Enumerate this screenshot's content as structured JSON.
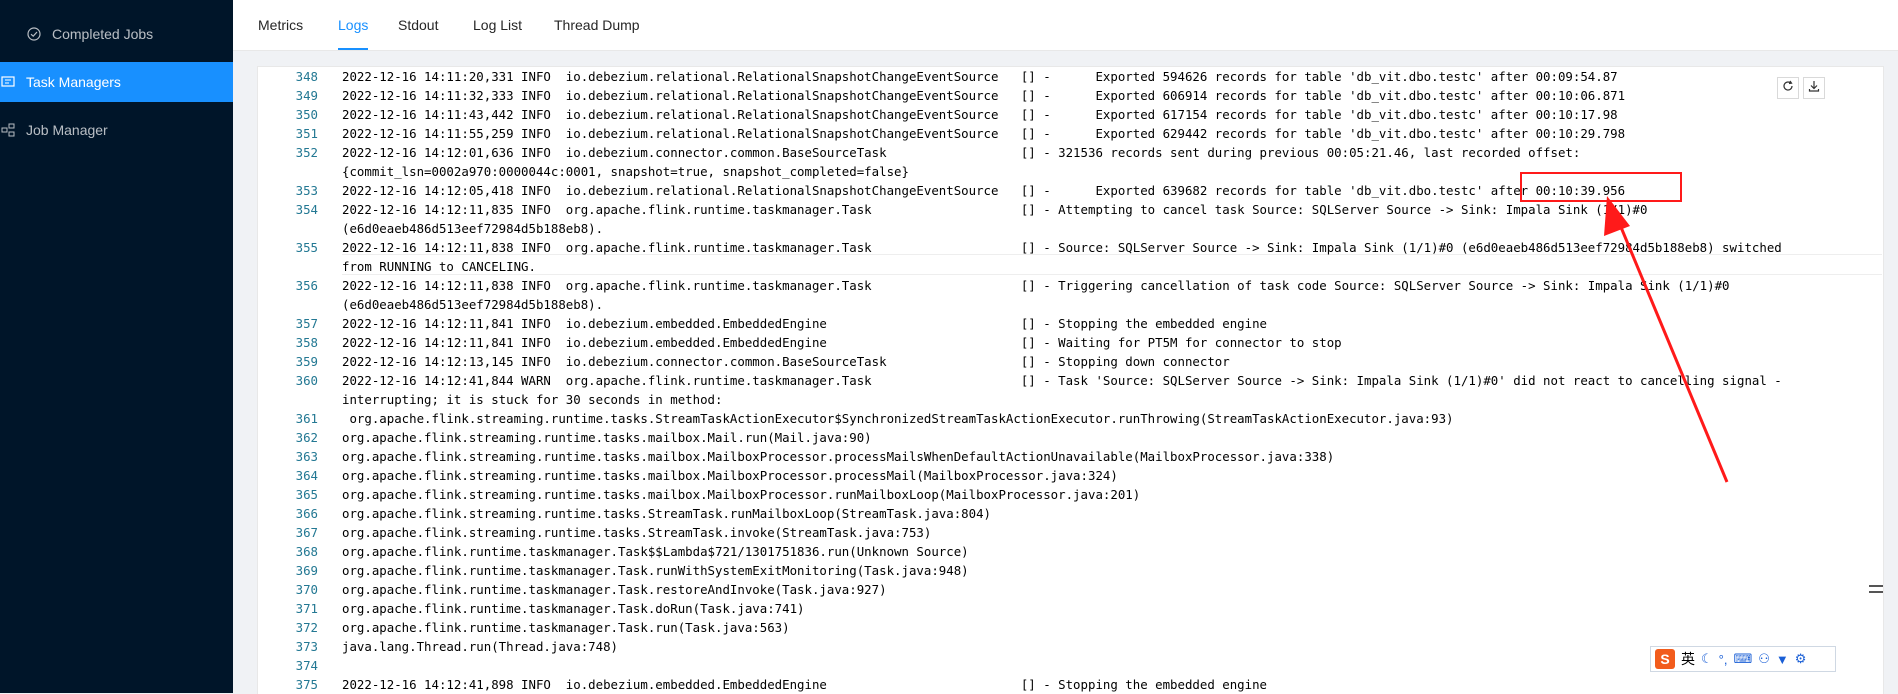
{
  "sidebar": {
    "items": [
      {
        "label": "Completed Jobs",
        "icon": "check-circle-icon"
      },
      {
        "label": "Task Managers",
        "icon": "monitor-icon"
      },
      {
        "label": "Job Manager",
        "icon": "cluster-icon"
      }
    ]
  },
  "tabs": [
    "Metrics",
    "Logs",
    "Stdout",
    "Log List",
    "Thread Dump"
  ],
  "toolbar": {
    "reload_icon": "reload-icon",
    "download_icon": "download-icon"
  },
  "ime": {
    "logo": "S",
    "mode": "英"
  },
  "colors": {
    "sidebar": "#001529",
    "accent": "#1890ff",
    "highlight": "#ff1a1a"
  },
  "log_lines": [
    {
      "n": "348",
      "t": "2022-12-16 14:11:20,331 INFO  io.debezium.relational.RelationalSnapshotChangeEventSource   [] -      Exported 594626 records for table 'db_vit.dbo.testc' after 00:09:54.87"
    },
    {
      "n": "349",
      "t": "2022-12-16 14:11:32,333 INFO  io.debezium.relational.RelationalSnapshotChangeEventSource   [] -      Exported 606914 records for table 'db_vit.dbo.testc' after 00:10:06.871"
    },
    {
      "n": "350",
      "t": "2022-12-16 14:11:43,442 INFO  io.debezium.relational.RelationalSnapshotChangeEventSource   [] -      Exported 617154 records for table 'db_vit.dbo.testc' after 00:10:17.98"
    },
    {
      "n": "351",
      "t": "2022-12-16 14:11:55,259 INFO  io.debezium.relational.RelationalSnapshotChangeEventSource   [] -      Exported 629442 records for table 'db_vit.dbo.testc' after 00:10:29.798"
    },
    {
      "n": "352",
      "t": "2022-12-16 14:12:01,636 INFO  io.debezium.connector.common.BaseSourceTask                  [] - 321536 records sent during previous 00:05:21.46, last recorded offset:"
    },
    {
      "n": "",
      "t": "{commit_lsn=0002a970:0000044c:0001, snapshot=true, snapshot_completed=false}"
    },
    {
      "n": "353",
      "t": "2022-12-16 14:12:05,418 INFO  io.debezium.relational.RelationalSnapshotChangeEventSource   [] -      Exported 639682 records for table 'db_vit.dbo.testc' after 00:10:39.956"
    },
    {
      "n": "354",
      "t": "2022-12-16 14:12:11,835 INFO  org.apache.flink.runtime.taskmanager.Task                    [] - Attempting to cancel task Source: SQLServer Source -> Sink: Impala Sink (1/1)#0"
    },
    {
      "n": "",
      "t": "(e6d0eaeb486d513eef72984d5b188eb8)."
    },
    {
      "n": "355",
      "t": "2022-12-16 14:12:11,838 INFO  org.apache.flink.runtime.taskmanager.Task                    [] - Source: SQLServer Source -> Sink: Impala Sink (1/1)#0 (e6d0eaeb486d513eef72984d5b188eb8) switched"
    },
    {
      "n": "",
      "t": "from RUNNING to CANCELING."
    },
    {
      "n": "356",
      "t": "2022-12-16 14:12:11,838 INFO  org.apache.flink.runtime.taskmanager.Task                    [] - Triggering cancellation of task code Source: SQLServer Source -> Sink: Impala Sink (1/1)#0"
    },
    {
      "n": "",
      "t": "(e6d0eaeb486d513eef72984d5b188eb8)."
    },
    {
      "n": "357",
      "t": "2022-12-16 14:12:11,841 INFO  io.debezium.embedded.EmbeddedEngine                          [] - Stopping the embedded engine"
    },
    {
      "n": "358",
      "t": "2022-12-16 14:12:11,841 INFO  io.debezium.embedded.EmbeddedEngine                          [] - Waiting for PT5M for connector to stop"
    },
    {
      "n": "359",
      "t": "2022-12-16 14:12:13,145 INFO  io.debezium.connector.common.BaseSourceTask                  [] - Stopping down connector"
    },
    {
      "n": "360",
      "t": "2022-12-16 14:12:41,844 WARN  org.apache.flink.runtime.taskmanager.Task                    [] - Task 'Source: SQLServer Source -> Sink: Impala Sink (1/1)#0' did not react to cancelling signal -"
    },
    {
      "n": "",
      "t": "interrupting; it is stuck for 30 seconds in method:"
    },
    {
      "n": "361",
      "t": " org.apache.flink.streaming.runtime.tasks.StreamTaskActionExecutor$SynchronizedStreamTaskActionExecutor.runThrowing(StreamTaskActionExecutor.java:93)"
    },
    {
      "n": "362",
      "t": "org.apache.flink.streaming.runtime.tasks.mailbox.Mail.run(Mail.java:90)"
    },
    {
      "n": "363",
      "t": "org.apache.flink.streaming.runtime.tasks.mailbox.MailboxProcessor.processMailsWhenDefaultActionUnavailable(MailboxProcessor.java:338)"
    },
    {
      "n": "364",
      "t": "org.apache.flink.streaming.runtime.tasks.mailbox.MailboxProcessor.processMail(MailboxProcessor.java:324)"
    },
    {
      "n": "365",
      "t": "org.apache.flink.streaming.runtime.tasks.mailbox.MailboxProcessor.runMailboxLoop(MailboxProcessor.java:201)"
    },
    {
      "n": "366",
      "t": "org.apache.flink.streaming.runtime.tasks.StreamTask.runMailboxLoop(StreamTask.java:804)"
    },
    {
      "n": "367",
      "t": "org.apache.flink.streaming.runtime.tasks.StreamTask.invoke(StreamTask.java:753)"
    },
    {
      "n": "368",
      "t": "org.apache.flink.runtime.taskmanager.Task$$Lambda$721/1301751836.run(Unknown Source)"
    },
    {
      "n": "369",
      "t": "org.apache.flink.runtime.taskmanager.Task.runWithSystemExitMonitoring(Task.java:948)"
    },
    {
      "n": "370",
      "t": "org.apache.flink.runtime.taskmanager.Task.restoreAndInvoke(Task.java:927)"
    },
    {
      "n": "371",
      "t": "org.apache.flink.runtime.taskmanager.Task.doRun(Task.java:741)"
    },
    {
      "n": "372",
      "t": "org.apache.flink.runtime.taskmanager.Task.run(Task.java:563)"
    },
    {
      "n": "373",
      "t": "java.lang.Thread.run(Thread.java:748)"
    },
    {
      "n": "374",
      "t": ""
    },
    {
      "n": "375",
      "t": "2022-12-16 14:12:41,898 INFO  io.debezium.embedded.EmbeddedEngine                          [] - Stopping the embedded engine"
    }
  ]
}
